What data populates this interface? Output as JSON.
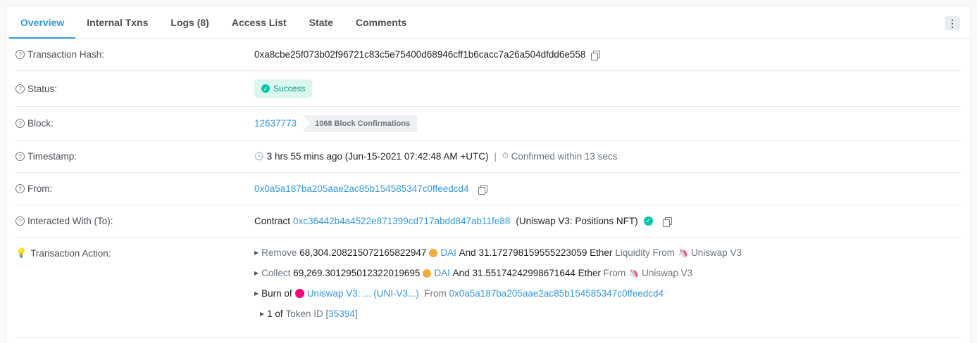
{
  "tabs": [
    {
      "label": "Overview"
    },
    {
      "label": "Internal Txns"
    },
    {
      "label": "Logs (8)"
    },
    {
      "label": "Access List"
    },
    {
      "label": "State"
    },
    {
      "label": "Comments"
    }
  ],
  "more_label": "⋮",
  "tx_hash": {
    "label": "Transaction Hash:",
    "value": "0xa8cbe25f073b02f96721c83c5e75400d68946cff1b6cacc7a26a504dfdd6e558"
  },
  "status": {
    "label": "Status:",
    "value": "Success"
  },
  "block": {
    "label": "Block:",
    "number": "12637773",
    "confirmations": "1068 Block Confirmations"
  },
  "timestamp": {
    "label": "Timestamp:",
    "value": "3 hrs 55 mins ago (Jun-15-2021 07:42:48 AM +UTC)",
    "separator": "|",
    "confirmed": "Confirmed within 13 secs"
  },
  "from": {
    "label": "From:",
    "address": "0x0a5a187ba205aae2ac85b154585347c0ffeedcd4"
  },
  "to": {
    "label": "Interacted With (To):",
    "prefix": "Contract",
    "address": "0xc36442b4a4522e871399cd717abdd847ab11fe88",
    "name": "(Uniswap V3: Positions NFT)"
  },
  "action": {
    "label": "Transaction Action:",
    "lines": [
      {
        "verb": "Remove",
        "amount1": "68,304.208215072165822947",
        "token1": "DAI",
        "and": "And",
        "amount2": "31.172798159555223059",
        "token2": "Ether",
        "tail": "Liquidity From",
        "protocol": "Uniswap V3"
      },
      {
        "verb": "Collect",
        "amount1": "69,269.301295012322019695",
        "token1": "DAI",
        "and": "And",
        "amount2": "31.55174242998671644",
        "token2": "Ether",
        "tail": "From",
        "protocol": "Uniswap V3"
      }
    ],
    "burn": {
      "verb": "Burn of",
      "token": "Uniswap V3: ... (UNI-V3...)",
      "from_label": "From",
      "from_address": "0x0a5a187ba205aae2ac85b154585347c0ffeedcd4"
    },
    "token_id": {
      "count": "1 of",
      "label": "Token ID",
      "open": "[",
      "id": "35394",
      "close": "]"
    }
  },
  "colors": {
    "accent": "#3498db",
    "success": "#00c9a7",
    "dai": "#f5ac37",
    "uni_pink": "#ff007a"
  }
}
